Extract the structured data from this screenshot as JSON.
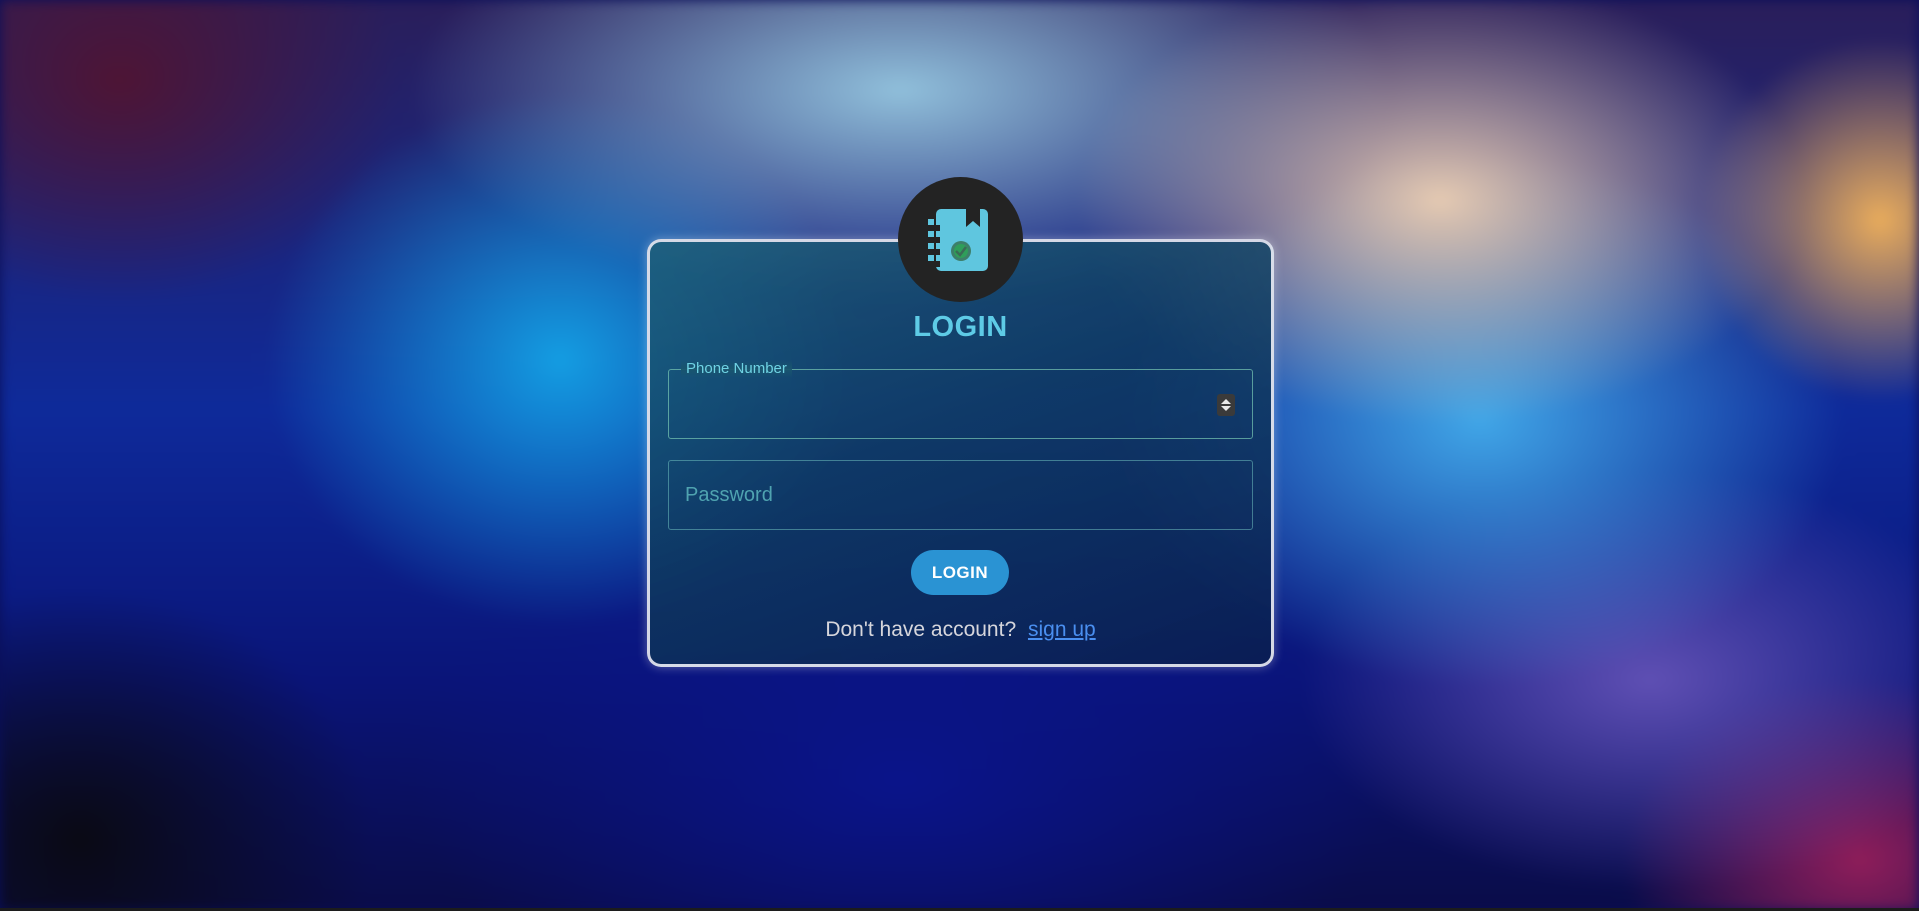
{
  "login_card": {
    "title": "LOGIN",
    "logo_icon": "address-book-icon",
    "phone_field": {
      "label": "Phone Number",
      "value": "",
      "placeholder": ""
    },
    "password_field": {
      "value": "",
      "placeholder": "Password"
    },
    "login_button_label": "LOGIN",
    "signup_prompt": "Don't have account?",
    "signup_link_label": "sign up"
  },
  "colors": {
    "accent": "#5ecbe6",
    "button": "#2a93d3",
    "link": "#4a8ff0",
    "logo_bg": "#232323"
  }
}
